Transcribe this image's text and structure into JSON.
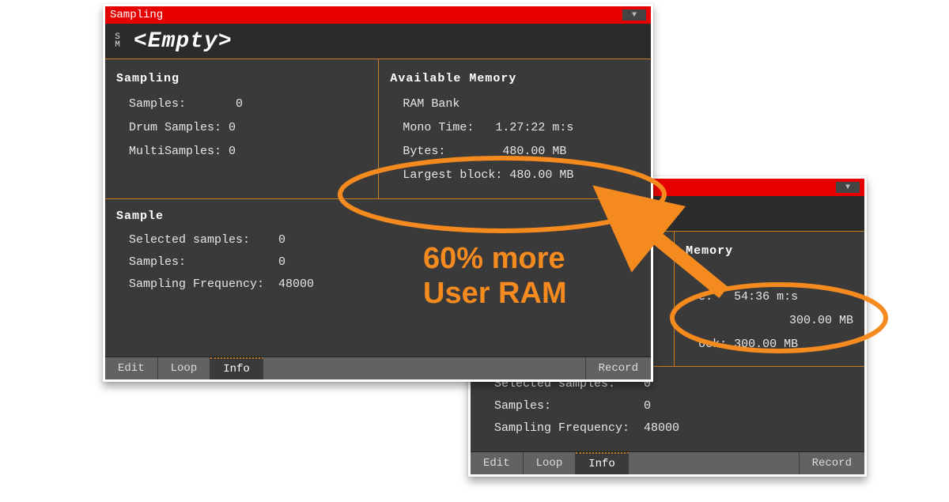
{
  "colors": {
    "titlebar": "#e60000",
    "panel_border": "#c97a24",
    "accent": "#f58a1f"
  },
  "annotation": {
    "line1": "60% more",
    "line2": "User RAM"
  },
  "front": {
    "title": "Sampling",
    "sm_label": "S\nM",
    "header_value": "<Empty>",
    "sampling_section": {
      "title": "Sampling",
      "samples_label": "Samples:       ",
      "samples_value": "0",
      "drum_label": "Drum Samples: ",
      "drum_value": "0",
      "multi_label": "MultiSamples: ",
      "multi_value": "0"
    },
    "memory_section": {
      "title": "Available Memory",
      "bank_label": "RAM Bank",
      "mono_label": "Mono Time:   ",
      "mono_value": "1.27:22 m:s",
      "bytes_label": "Bytes:        ",
      "bytes_value": "480.00 MB",
      "block_label": "Largest block: ",
      "block_value": "480.00 MB"
    },
    "sample_section": {
      "title": "Sample",
      "sel_label": "Selected samples:    ",
      "sel_value": "0",
      "samp_label": "Samples:             ",
      "samp_value": "0",
      "freq_label": "Sampling Frequency:  ",
      "freq_value": "48000"
    },
    "tabs": {
      "edit": "Edit",
      "loop": "Loop",
      "info": "Info",
      "record": "Record"
    }
  },
  "back": {
    "memory_section": {
      "title_fragment": "Memory",
      "mono_label": "e:   ",
      "mono_value": "54:36 m:s",
      "bytes_value": "300.00 MB",
      "block_label": "ock: ",
      "block_value": "300.00 MB"
    },
    "sample_section": {
      "sel_label": "Selected samples:    ",
      "sel_value": "0",
      "samp_label": "Samples:             ",
      "samp_value": "0",
      "freq_label": "Sampling Frequency:  ",
      "freq_value": "48000"
    },
    "tabs": {
      "edit": "Edit",
      "loop": "Loop",
      "info": "Info",
      "record": "Record"
    }
  }
}
